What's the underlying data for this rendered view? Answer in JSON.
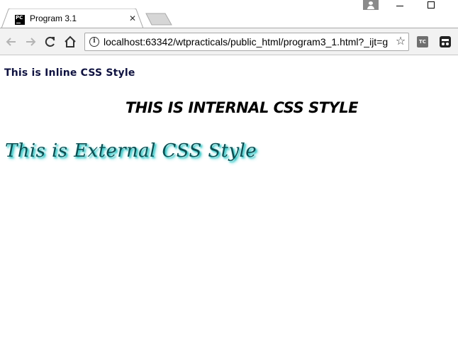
{
  "browser": {
    "tab": {
      "title": "Program 3.1",
      "favicon_text": "PC",
      "close_glyph": "✕"
    },
    "address_bar": {
      "url": "localhost:63342/wtpracticals/public_html/program3_1.html?_ijt=g"
    },
    "extensions": {
      "tc_label": "TC"
    },
    "icons": [
      "back-icon",
      "forward-icon",
      "reload-icon",
      "home-icon",
      "info-icon",
      "star-icon",
      "incognito-icon"
    ]
  },
  "page": {
    "inline_text": "This is Inline CSS Style",
    "internal_text": "THIS IS INTERNAL CSS STYLE",
    "external_text": "This is External CSS Style",
    "colors": {
      "inline": "#0f1240",
      "internal": "#000000",
      "external": "#0d4f52",
      "external_shadow": "#2bc3c3"
    }
  }
}
